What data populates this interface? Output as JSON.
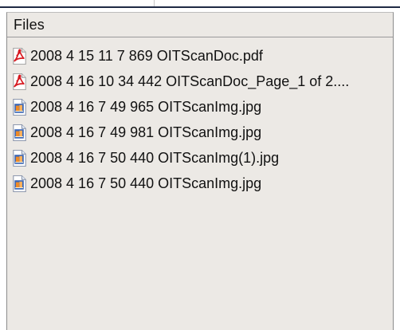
{
  "files_panel": {
    "header": "Files",
    "items": [
      {
        "name": "2008 4 15 11 7 869 OITScanDoc.pdf",
        "icon": "pdf-icon"
      },
      {
        "name": "2008 4 16 10 34 442 OITScanDoc_Page_1 of 2....",
        "icon": "pdf-icon"
      },
      {
        "name": "2008 4 16 7 49 965 OITScanImg.jpg",
        "icon": "image-file-icon"
      },
      {
        "name": "2008 4 16 7 49 981 OITScanImg.jpg",
        "icon": "image-file-icon"
      },
      {
        "name": "2008 4 16 7 50 440 OITScanImg(1).jpg",
        "icon": "image-file-icon"
      },
      {
        "name": "2008 4 16 7 50 440 OITScanImg.jpg",
        "icon": "image-file-icon"
      }
    ]
  },
  "colors": {
    "panel_background": "#ece9e5",
    "border": "#8c8c8c",
    "pdf_red": "#d71920",
    "image_orange": "#f08a24",
    "image_blue": "#3b67b6"
  }
}
